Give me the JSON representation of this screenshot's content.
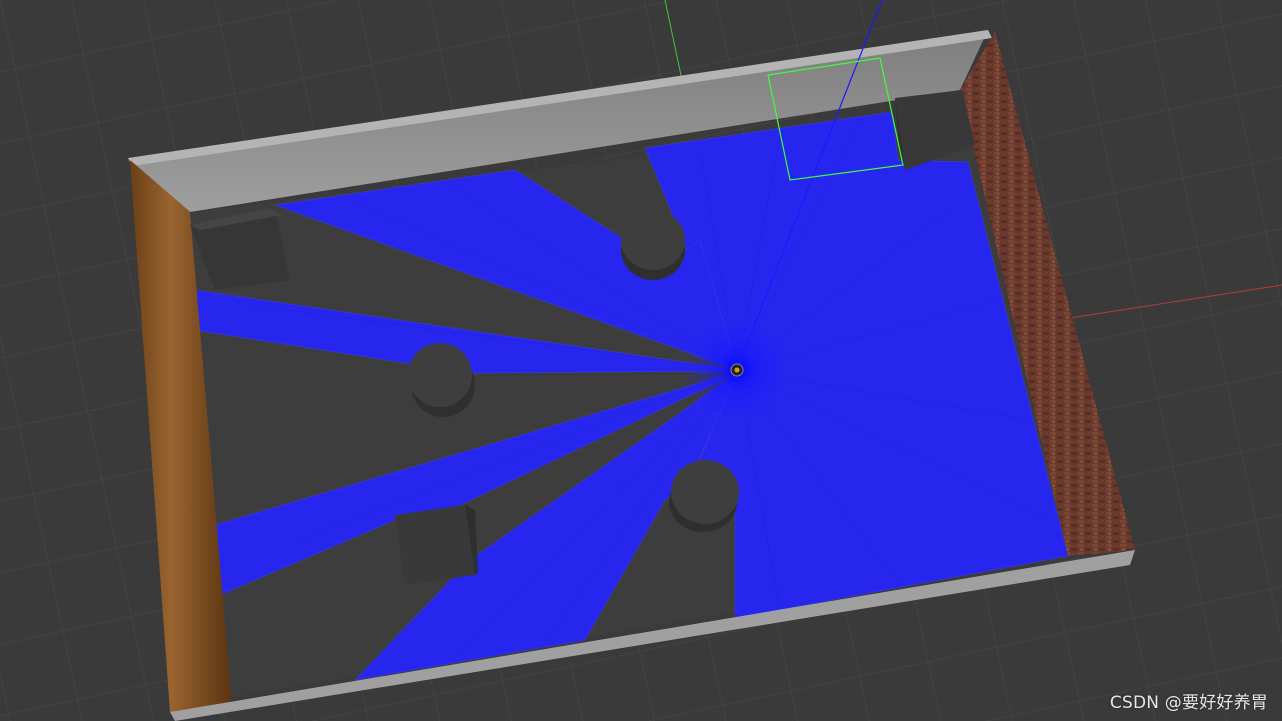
{
  "watermark": {
    "text": "CSDN @要好好养胃"
  },
  "colors": {
    "background": "#3a3a3a",
    "grid": "#4a4a4a",
    "laser": "#2424ff",
    "z_axis": "#1a1aff",
    "x_axis": "#b83a3a",
    "y_axis": "#3ec43e",
    "selection_box": "#3cff3c",
    "wall_wood": "#8a5a2a",
    "wall_brick": "#6a3a2e",
    "wall_gray": "#9a9a9a",
    "obstacle": "#3e3e3e"
  },
  "icons": {
    "robot": "robot-sensor-icon"
  }
}
